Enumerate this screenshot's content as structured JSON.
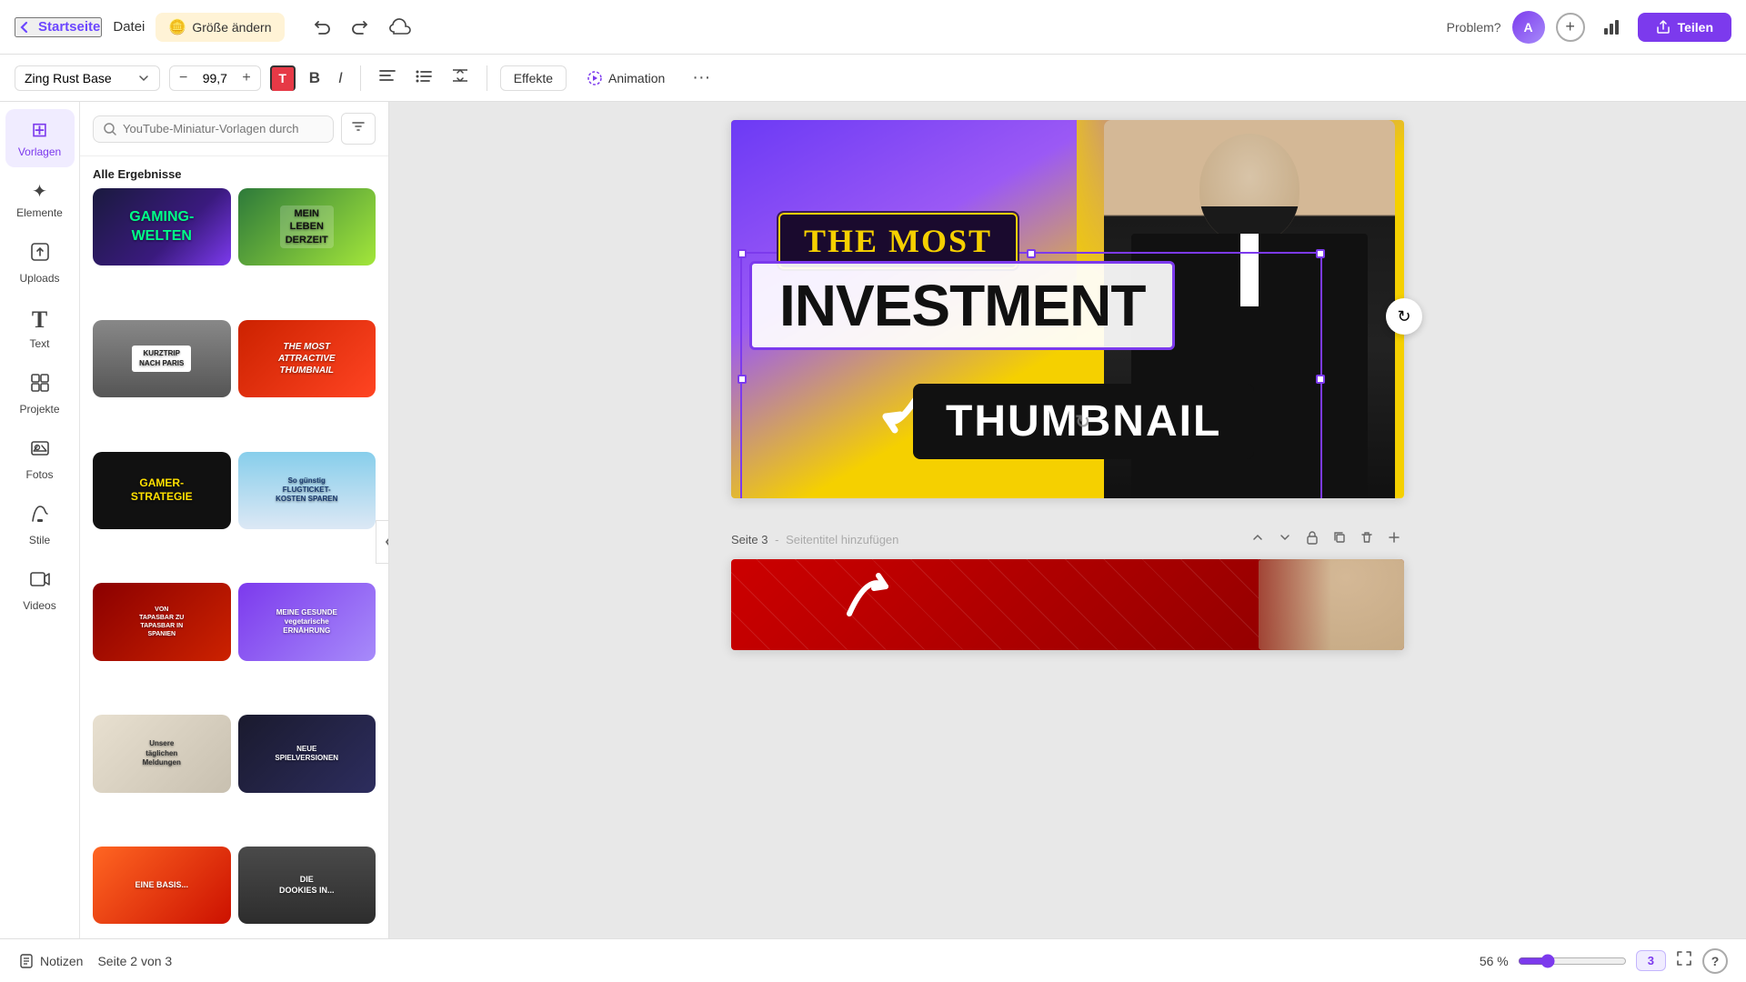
{
  "topbar": {
    "back_label": "Startseite",
    "file_label": "Datei",
    "resize_label": "Größe ändern",
    "problem_label": "Problem?",
    "share_label": "Teilen"
  },
  "toolbar": {
    "font_name": "Zing Rust Base",
    "font_size": "99,7",
    "effekte_label": "Effekte",
    "animation_label": "Animation"
  },
  "sidebar": {
    "items": [
      {
        "id": "vorlagen",
        "label": "Vorlagen",
        "icon": "⊞"
      },
      {
        "id": "elemente",
        "label": "Elemente",
        "icon": "✦"
      },
      {
        "id": "uploads",
        "label": "Uploads",
        "icon": "↑"
      },
      {
        "id": "text",
        "label": "Text",
        "icon": "T"
      },
      {
        "id": "projekte",
        "label": "Projekte",
        "icon": "▣"
      },
      {
        "id": "fotos",
        "label": "Fotos",
        "icon": "🖼"
      },
      {
        "id": "stile",
        "label": "Stile",
        "icon": "◈"
      },
      {
        "id": "videos",
        "label": "Videos",
        "icon": "▶"
      }
    ]
  },
  "panel": {
    "search_placeholder": "YouTube-Miniatur-Vorlagen durch",
    "section_title": "Alle Ergebnisse",
    "templates": [
      {
        "id": 1,
        "class": "tc-1",
        "text": "GAMING-\nWELTEN"
      },
      {
        "id": 2,
        "class": "tc-2",
        "text": "MEIN\nLEBEN\nDERZEIT"
      },
      {
        "id": 3,
        "class": "tc-3",
        "text": "KURZTRIP\nNACH PARIS"
      },
      {
        "id": 4,
        "class": "tc-4",
        "text": "THE MOST\nATTRACTIVE\nTHUMBNAIL"
      },
      {
        "id": 5,
        "class": "tc-5",
        "text": "GAMER-\nSTRATEGIE"
      },
      {
        "id": 6,
        "class": "tc-6",
        "text": "So günstig\nFLUGTICKET-\nKOSTEN SPAREN"
      },
      {
        "id": 7,
        "class": "tc-7",
        "text": "VON\nTAPASBAR ZU\nTAPASBAR IN\nSPANIEN"
      },
      {
        "id": 8,
        "class": "tc-8",
        "text": "MEINE GESUNDE\nERNÄHRUNG"
      },
      {
        "id": 9,
        "class": "tc-9",
        "text": "Unsere\ntäglichen\nMeldungen"
      },
      {
        "id": 10,
        "class": "tc-10",
        "text": "NEUE\nSPIELVERSIONEN"
      },
      {
        "id": 11,
        "class": "tc-11",
        "text": "EINE BASIS..."
      },
      {
        "id": 12,
        "class": "tc-12",
        "text": "DIE\nDOOKIES IN..."
      }
    ]
  },
  "canvas": {
    "page2": {
      "label": "Seite 2 von 3",
      "the_most_text": "THE MOST",
      "investment_text": "INVESTMENT",
      "thumbnail_text": "THUMBNAIL"
    },
    "page3": {
      "label": "Seite 3",
      "subtitle": "Seitentitel hinzufügen"
    }
  },
  "bottombar": {
    "notes_label": "Notizen",
    "page_label": "Seite 2 von 3",
    "zoom_value": "56 %",
    "help_label": "?"
  }
}
